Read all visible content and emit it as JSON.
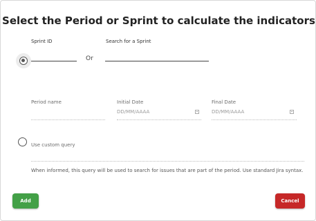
{
  "dialog": {
    "title": "Select the Period or Sprint to calculate the indicators"
  },
  "sprint": {
    "id_label": "Sprint ID",
    "or_label": "Or",
    "search_label": "Search for a Sprint",
    "selected": true
  },
  "period": {
    "name_label": "Period name",
    "initial_label": "Initial Date",
    "initial_placeholder": "DD/MM/AAAA",
    "final_label": "Final Date",
    "final_placeholder": "DD/MM/AAAA"
  },
  "custom_query": {
    "label": "Use custom query",
    "selected": false,
    "help": "When informed, this query will be used to search for issues that are part of the period. Use standard Jira syntax."
  },
  "buttons": {
    "add": "Add",
    "cancel": "Cancel"
  },
  "colors": {
    "add": "#43a047",
    "cancel": "#c62828"
  }
}
